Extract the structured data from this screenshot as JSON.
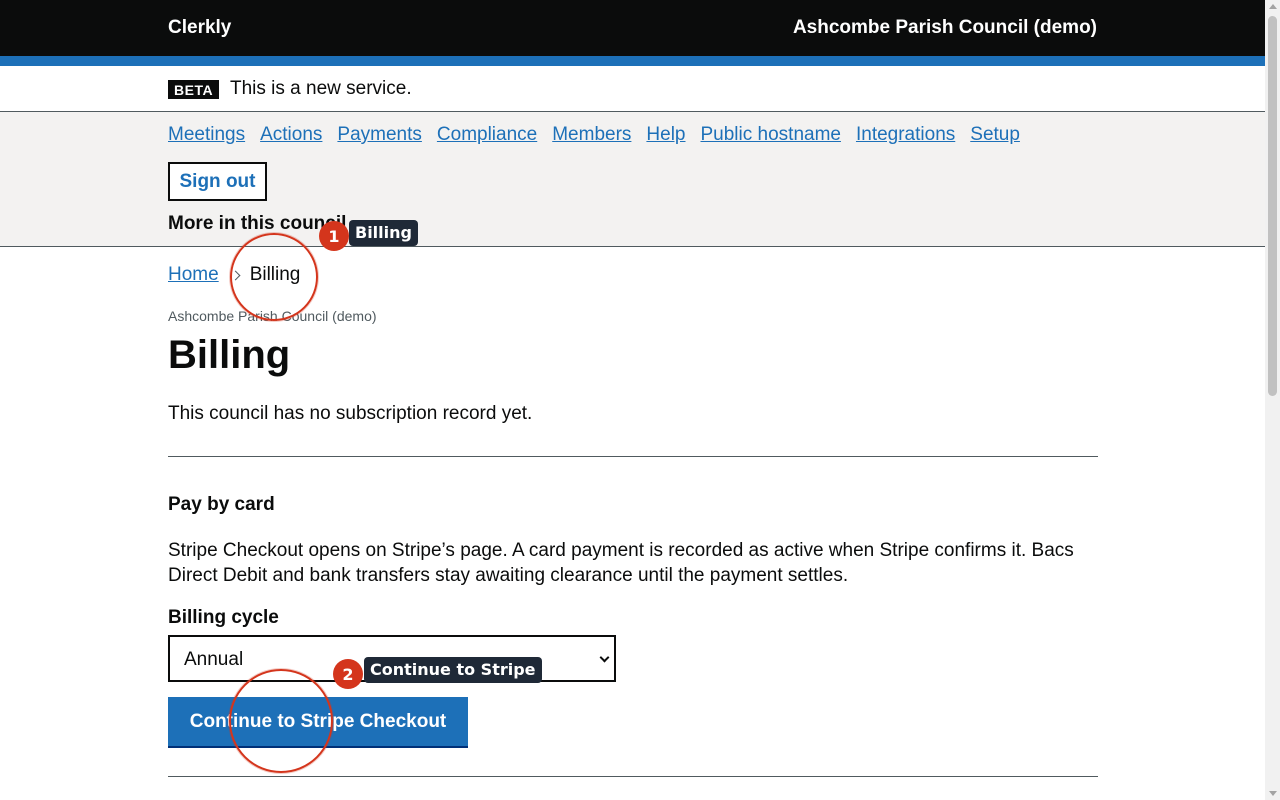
{
  "header": {
    "brand": "Clerkly",
    "council_name": "Ashcombe Parish Council (demo)"
  },
  "phase_banner": {
    "tag": "BETA",
    "text": "This is a new service."
  },
  "nav": {
    "links": [
      {
        "label": "Meetings"
      },
      {
        "label": "Actions"
      },
      {
        "label": "Payments"
      },
      {
        "label": "Compliance"
      },
      {
        "label": "Members"
      },
      {
        "label": "Help"
      },
      {
        "label": "Public hostname"
      },
      {
        "label": "Integrations"
      },
      {
        "label": "Setup"
      }
    ],
    "sign_out": "Sign out",
    "more_heading": "More in this council"
  },
  "breadcrumb": {
    "home": "Home",
    "current": "Billing"
  },
  "page": {
    "caption": "Ashcombe Parish Council (demo)",
    "title": "Billing",
    "intro": "This council has no subscription record yet."
  },
  "pay_by_card": {
    "heading": "Pay by card",
    "body": "Stripe Checkout opens on Stripe’s page. A card payment is recorded as active when Stripe confirms it. Bacs Direct Debit and bank transfers stay awaiting clearance until the payment settles.",
    "cycle_label": "Billing cycle",
    "cycle_value": "Annual",
    "submit_label": "Continue to Stripe Checkout"
  },
  "markers": [
    {
      "number": "1",
      "label": "Billing"
    },
    {
      "number": "2",
      "label": "Continue to Stripe"
    }
  ],
  "colors": {
    "link": "#1d70b8",
    "header_bg": "#0b0c0c",
    "accent_bar": "#1d70b8",
    "marker": "#d4351c"
  }
}
